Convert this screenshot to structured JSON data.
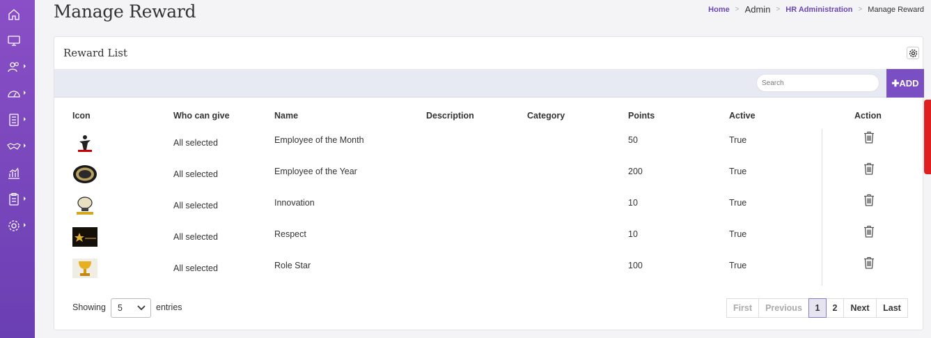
{
  "page": {
    "title": "Manage Reward",
    "breadcrumb": [
      "Home",
      "Admin",
      "HR Administration",
      "Manage Reward"
    ]
  },
  "sidebar": {
    "items": [
      {
        "icon": "home-icon",
        "has_submenu": false
      },
      {
        "icon": "monitor-icon",
        "has_submenu": false
      },
      {
        "icon": "users-icon",
        "has_submenu": true
      },
      {
        "icon": "dashboard-gauge-icon",
        "has_submenu": true
      },
      {
        "icon": "list-icon",
        "has_submenu": true
      },
      {
        "icon": "handshake-icon",
        "has_submenu": true
      },
      {
        "icon": "chart-icon",
        "has_submenu": true
      },
      {
        "icon": "clipboard-icon",
        "has_submenu": true
      },
      {
        "icon": "settings-icon",
        "has_submenu": true
      }
    ]
  },
  "card": {
    "title": "Reward List",
    "search_placeholder": "Search",
    "add_label": "ADD"
  },
  "table": {
    "columns": [
      "Icon",
      "Who can give",
      "Name",
      "Description",
      "Category",
      "Points",
      "Active",
      "Action"
    ],
    "rows": [
      {
        "icon": "employee-of-month-image",
        "who": "All selected",
        "name": "Employee of the Month",
        "description": "",
        "category": "",
        "points": "50",
        "active": "True"
      },
      {
        "icon": "employee-of-year-image",
        "who": "All selected",
        "name": "Employee of the Year",
        "description": "",
        "category": "",
        "points": "200",
        "active": "True"
      },
      {
        "icon": "innovation-image",
        "who": "All selected",
        "name": "Innovation",
        "description": "",
        "category": "",
        "points": "10",
        "active": "True"
      },
      {
        "icon": "respect-image",
        "who": "All selected",
        "name": "Respect",
        "description": "",
        "category": "",
        "points": "10",
        "active": "True"
      },
      {
        "icon": "role-star-image",
        "who": "All selected",
        "name": "Role Star",
        "description": "",
        "category": "",
        "points": "100",
        "active": "True"
      }
    ]
  },
  "footer": {
    "showing": "Showing",
    "entries_value": "5",
    "entries": "entries"
  },
  "pagination": {
    "first": "First",
    "previous": "Previous",
    "pages": [
      "1",
      "2"
    ],
    "current": "1",
    "next": "Next",
    "last": "Last"
  },
  "colors": {
    "accent": "#7a4fc4",
    "breadcrumb_link": "#6b46b8"
  }
}
